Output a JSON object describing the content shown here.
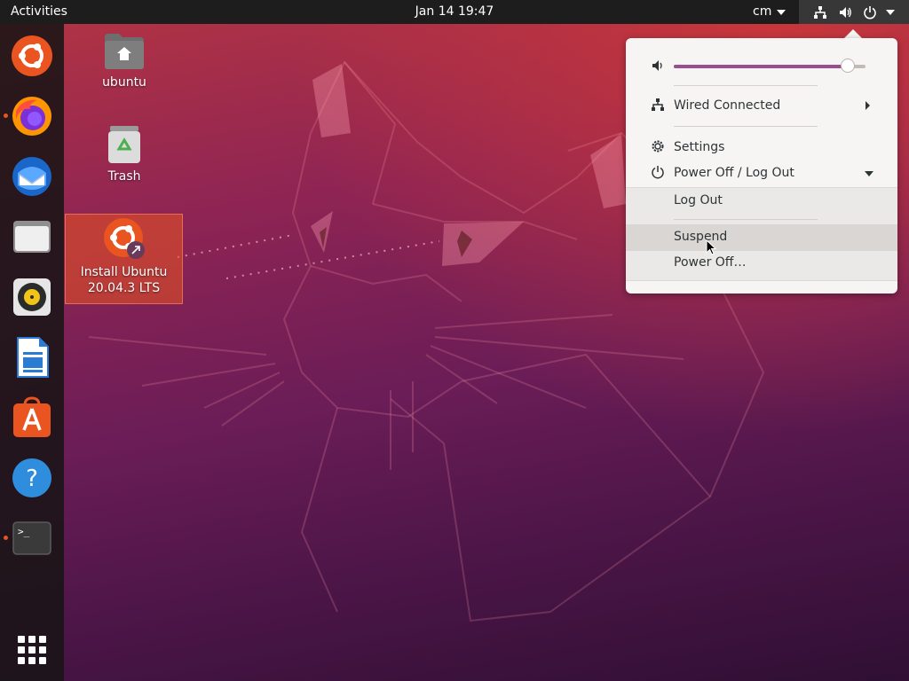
{
  "topbar": {
    "activities": "Activities",
    "clock": "Jan 14  19:47",
    "input_method": "cm"
  },
  "dock": {
    "items": [
      {
        "name": "Ubuntu installer"
      },
      {
        "name": "Firefox",
        "running": true
      },
      {
        "name": "Thunderbird"
      },
      {
        "name": "Files"
      },
      {
        "name": "Rhythmbox"
      },
      {
        "name": "LibreOffice Writer"
      },
      {
        "name": "Ubuntu Software"
      },
      {
        "name": "Help"
      },
      {
        "name": "Terminal",
        "running": true
      }
    ],
    "apps_icon": "show-applications-icon"
  },
  "desktop": {
    "home_label": "ubuntu",
    "trash_label": "Trash",
    "install_label_line1": "Install Ubuntu",
    "install_label_line2": "20.04.3 LTS"
  },
  "menu": {
    "volume_level": 0.94,
    "network_label": "Wired Connected",
    "settings_label": "Settings",
    "power_label": "Power Off / Log Out",
    "power_submenu": {
      "logout_label": "Log Out",
      "suspend_label": "Suspend",
      "poweroff_label": "Power Off…"
    }
  },
  "colors": {
    "accent": "#e95420",
    "slider_fill": "#9a4e8c",
    "topbar": "#1d1d1d",
    "menu_bg": "#f6f5f4"
  }
}
